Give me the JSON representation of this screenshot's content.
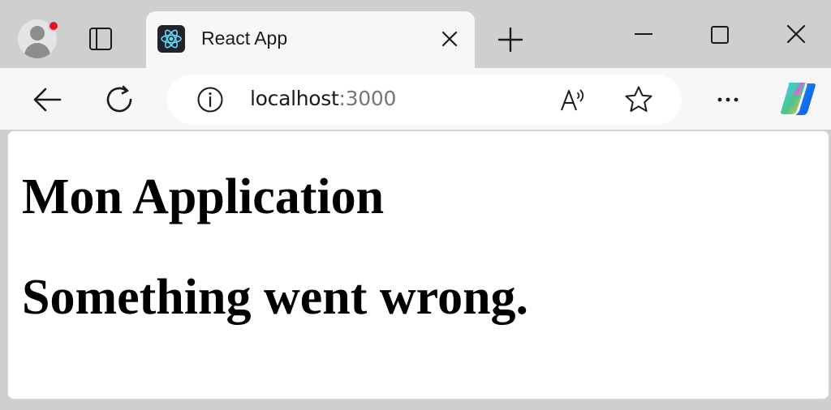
{
  "browser": {
    "tab": {
      "title": "React App",
      "favicon": "react-logo-icon"
    },
    "address_bar": {
      "host": "localhost",
      "port": ":3000"
    },
    "icons": {
      "profile": "profile-avatar-icon",
      "tab_actions": "tab-actions-icon",
      "new_tab": "plus-icon",
      "minimize": "minimize-icon",
      "maximize": "maximize-icon",
      "close": "close-icon",
      "back": "back-arrow-icon",
      "reload": "reload-icon",
      "site_info": "info-icon",
      "read_aloud": "read-aloud-icon",
      "favorite": "star-icon",
      "more": "more-icon",
      "copilot": "copilot-icon"
    },
    "colors": {
      "chrome": "#cfcfcf",
      "toolbar": "#f7f7f7",
      "notification_dot": "#e81123",
      "react_bg": "#20232a",
      "react_accent": "#61dafb"
    }
  },
  "page": {
    "heading": "Mon Application",
    "error_message": "Something went wrong."
  }
}
